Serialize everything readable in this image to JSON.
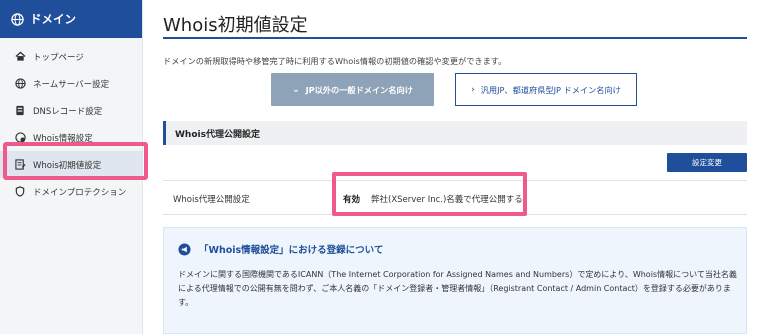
{
  "sidebar": {
    "header_label": "ドメイン",
    "items": [
      {
        "label": "トップページ",
        "icon": "home-icon"
      },
      {
        "label": "ネームサーバー設定",
        "icon": "globe-gear-icon"
      },
      {
        "label": "DNSレコード設定",
        "icon": "server-icon"
      },
      {
        "label": "Whois情報設定",
        "icon": "globe-person-icon"
      },
      {
        "label": "Whois初期値設定",
        "icon": "document-edit-icon",
        "active": true
      },
      {
        "label": "ドメインプロテクション",
        "icon": "shield-icon"
      }
    ]
  },
  "main": {
    "title": "Whois初期値設定",
    "description": "ドメインの新規取得時や移管完了時に利用するWhois情報の初期値の確認や変更ができます。",
    "tabs": [
      {
        "label": "JP以外の一般ドメイン名向け",
        "selected": true
      },
      {
        "label": "汎用JP、都道府県型JP ドメイン名向け",
        "selected": false
      }
    ],
    "section_title": "Whois代理公開設定",
    "change_button": "設定変更",
    "setting": {
      "label": "Whois代理公開設定",
      "status": "有効",
      "value": "弊社(XServer Inc.)名義で代理公開する"
    },
    "info": {
      "heading": "「Whois情報設定」における登録について",
      "body": "ドメインに関する国際機関であるICANN（The Internet Corporation for Assigned Names and Numbers）で定めにより、Whois情報について当社名義による代理情報での公開有無を問わず、ご本人名義の「ドメイン登録者・管理者情報」（Registrant Contact / Admin Contact）を登録する必要があります。"
    }
  },
  "colors": {
    "brand": "#1f4e9a",
    "highlight": "#ee5a8a",
    "tab_selected": "#8ea3b8"
  }
}
